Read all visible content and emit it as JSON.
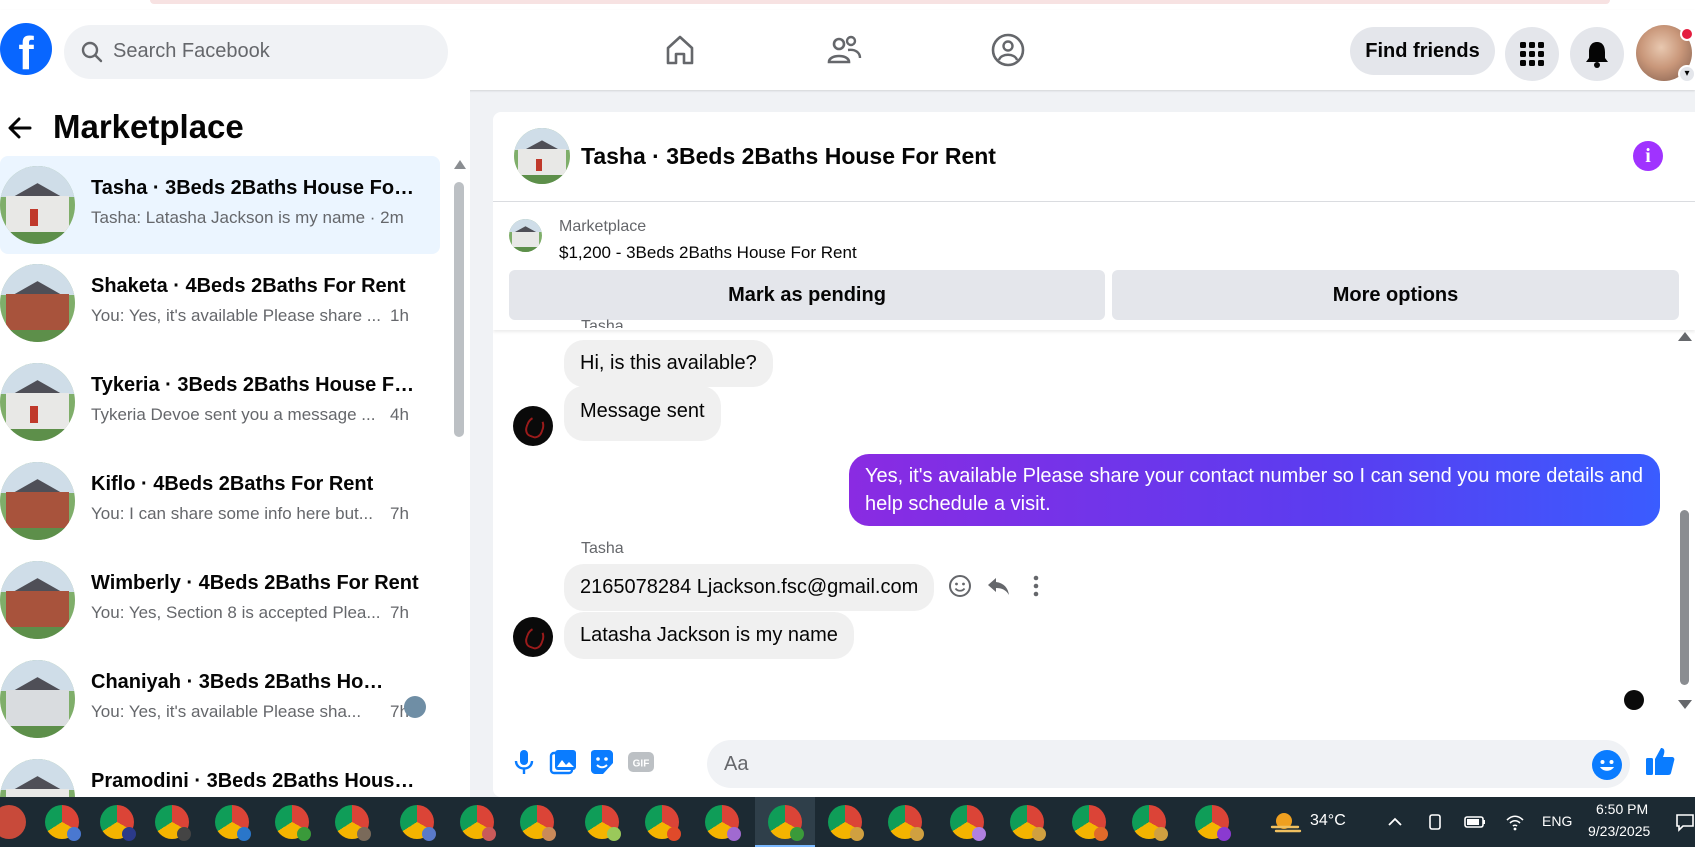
{
  "header": {
    "search_placeholder": "Search Facebook",
    "find_friends_label": "Find friends"
  },
  "sidebar": {
    "title": "Marketplace",
    "conversations": [
      {
        "name": "Tasha · 3Beds 2Baths House For ...",
        "preview": "Tasha: Latasha Jackson is my name · 2m",
        "time": ""
      },
      {
        "name": "Shaketa · 4Beds 2Baths For Rent",
        "preview": "You: Yes, it's available Please share ...",
        "time": "1h"
      },
      {
        "name": "Tykeria · 3Beds 2Baths House Fo...",
        "preview": "Tykeria Devoe sent you a message ...",
        "time": "4h"
      },
      {
        "name": "Kiflo · 4Beds 2Baths For Rent",
        "preview": "You: I can share some info here but...",
        "time": "7h"
      },
      {
        "name": "Wimberly · 4Beds 2Baths For Rent",
        "preview": "You: Yes, Section 8 is accepted Plea...",
        "time": "7h"
      },
      {
        "name": "Chaniyah · 3Beds 2Baths Hou...",
        "preview": "You: Yes, it's available Please sha...",
        "time": "7h"
      },
      {
        "name": "Pramodini · 3Beds 2Baths House...",
        "preview": "",
        "time": ""
      }
    ]
  },
  "chat": {
    "title": "Tasha · 3Beds 2Baths House For Rent",
    "listing_label": "Marketplace",
    "listing_price": "$1,200 - 3Beds 2Baths House For Rent",
    "mark_pending_label": "Mark as pending",
    "more_options_label": "More options",
    "messages": {
      "partial_sender": "Tasha",
      "m1": "Hi, is this available?",
      "m2": "Message sent",
      "m3": "Yes, it's available  Please share your contact number so I can send you more details and help schedule a visit.",
      "sender2": "Tasha",
      "m4": "2165078284 Ljackson.fsc@gmail.com",
      "m5": "Latasha Jackson is my name"
    },
    "composer_placeholder": "Aa"
  },
  "taskbar": {
    "weather": "34°C",
    "language": "ENG",
    "time": "6:50 PM",
    "date": "9/23/2025"
  },
  "colors": {
    "brand": "#0866ff",
    "accent_purple": "#a033ff",
    "my_bubble_start": "#8a2be2",
    "my_bubble_end": "#3a5cff"
  }
}
